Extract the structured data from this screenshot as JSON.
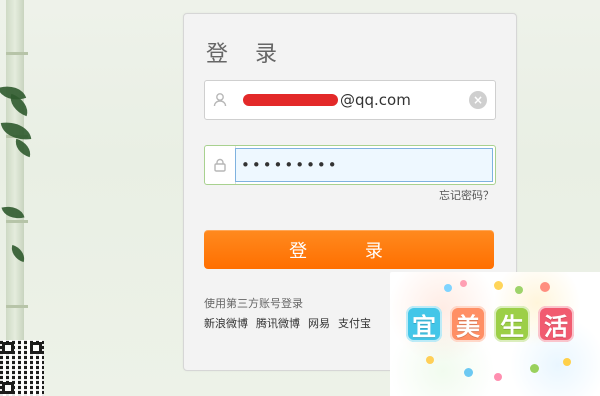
{
  "login": {
    "title": "登 录",
    "username_suffix": "@qq.com",
    "password_mask": "•••••••••",
    "forgot_password": "忘记密码？",
    "submit_label": "登 录"
  },
  "third_party": {
    "title": "使用第三方账号登录",
    "providers": [
      "新浪微博",
      "腾讯微博",
      "网易",
      "支付宝"
    ]
  },
  "brand": {
    "logo_text": [
      "宜",
      "美",
      "生",
      "活"
    ]
  },
  "icons": {
    "user": "user-icon",
    "lock": "lock-icon",
    "clear": "clear-icon"
  },
  "colors": {
    "button": "#ff6f00",
    "input_focus": "#7fb2df",
    "redaction": "#e21d1d"
  }
}
